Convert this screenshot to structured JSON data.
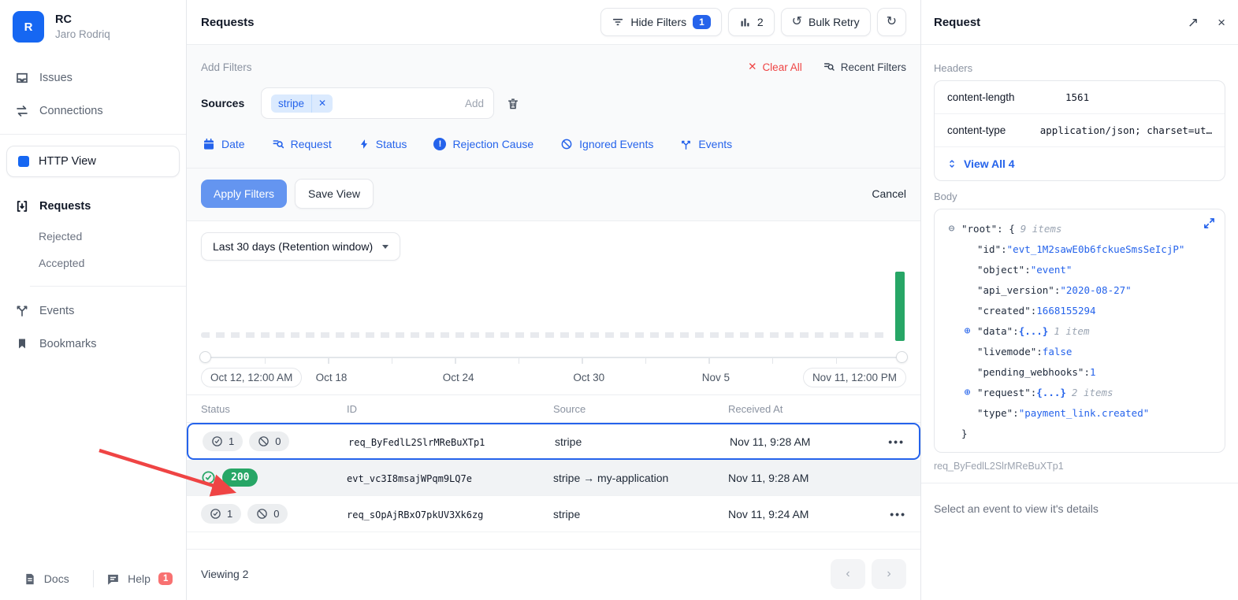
{
  "accent": "#2563eb",
  "green": "#27a666",
  "sidebar": {
    "org_initial": "R",
    "org_name": "RC",
    "user_name": "Jaro Rodriq",
    "issues": "Issues",
    "connections": "Connections",
    "http_view": "HTTP View",
    "requests": "Requests",
    "rejected": "Rejected",
    "accepted": "Accepted",
    "events": "Events",
    "bookmarks": "Bookmarks",
    "docs": "Docs",
    "help": "Help",
    "help_badge": "1"
  },
  "header": {
    "title": "Requests",
    "hide_filters": "Hide Filters",
    "hide_filters_badge": "1",
    "chart_count": "2",
    "bulk_retry": "Bulk Retry"
  },
  "filters": {
    "add_filters": "Add Filters",
    "clear_all": "Clear All",
    "recent_filters": "Recent Filters",
    "sources_label": "Sources",
    "source_chip": "stripe",
    "add_label": "Add",
    "chip_date": "Date",
    "chip_request": "Request",
    "chip_status": "Status",
    "chip_rejection": "Rejection Cause",
    "chip_ignored": "Ignored Events",
    "chip_events": "Events",
    "apply": "Apply Filters",
    "save_view": "Save View",
    "cancel": "Cancel"
  },
  "chart": {
    "range_label": "Last 30 days (Retention window)",
    "tick_start": "Oct 12, 12:00 AM",
    "tick_18": "Oct 18",
    "tick_24": "Oct 24",
    "tick_30": "Oct 30",
    "tick_nov5": "Nov 5",
    "tick_end": "Nov 11, 12:00 PM"
  },
  "chart_data": {
    "type": "bar",
    "title": "Requests over retention window",
    "x_ticks": [
      "Oct 12, 12:00 AM",
      "Oct 18",
      "Oct 24",
      "Oct 30",
      "Nov 5",
      "Nov 11, 12:00 PM"
    ],
    "bars": [
      {
        "x": "Nov 11",
        "value": 2,
        "color": "#27a666"
      }
    ],
    "baseline": "dashed zero line across full range, all other buckets empty"
  },
  "table": {
    "col_status": "Status",
    "col_id": "ID",
    "col_source": "Source",
    "col_received": "Received At",
    "rows": [
      {
        "ok_count": "1",
        "rejected_count": "0",
        "id": "req_ByFedlL2SlrMReBuXTp1",
        "source": "stripe",
        "received": "Nov 11, 9:28 AM",
        "menu": "•••"
      },
      {
        "status_code": "200",
        "id": "evt_vc3I8msajWPqm9LQ7e",
        "source": "stripe → my-application",
        "received": "Nov 11, 9:28 AM"
      },
      {
        "ok_count": "1",
        "rejected_count": "0",
        "id": "req_sOpAjRBxO7pkUV3Xk6zg",
        "source": "stripe",
        "received": "Nov 11, 9:24 AM",
        "menu": "•••"
      }
    ],
    "footer": "Viewing 2"
  },
  "panel": {
    "title": "Request",
    "headers_label": "Headers",
    "headers": [
      {
        "key": "content-length",
        "value": "1561"
      },
      {
        "key": "content-type",
        "value": "application/json; charset=ut…"
      }
    ],
    "view_all": "View All 4",
    "body_label": "Body",
    "json": {
      "lines": [
        {
          "key": "\"root\"",
          "sep": " : {",
          "meta": "9 items"
        },
        {
          "key": "\"id\"",
          "sep": " : ",
          "value": "\"evt_1M2sawE0b6fckueSmsSeIcjP\""
        },
        {
          "key": "\"object\"",
          "sep": " : ",
          "value": "\"event\""
        },
        {
          "key": "\"api_version\"",
          "sep": " : ",
          "value": "\"2020-08-27\""
        },
        {
          "key": "\"created\"",
          "sep": " : ",
          "value": "1668155294"
        },
        {
          "key": "\"data\"",
          "sep": " : ",
          "value": "{...}",
          "meta": "1 item"
        },
        {
          "key": "\"livemode\"",
          "sep": " : ",
          "value": "false"
        },
        {
          "key": "\"pending_webhooks\"",
          "sep": " : ",
          "value": "1"
        },
        {
          "key": "\"request\"",
          "sep": " : ",
          "value": "{...}",
          "meta": "2 items"
        },
        {
          "key": "\"type\"",
          "sep": " : ",
          "value": "\"payment_link.created\""
        },
        {
          "close": "}"
        }
      ]
    },
    "request_id": "req_ByFedlL2SlrMReBuXTp1",
    "empty_text": "Select an event to view it's details"
  }
}
